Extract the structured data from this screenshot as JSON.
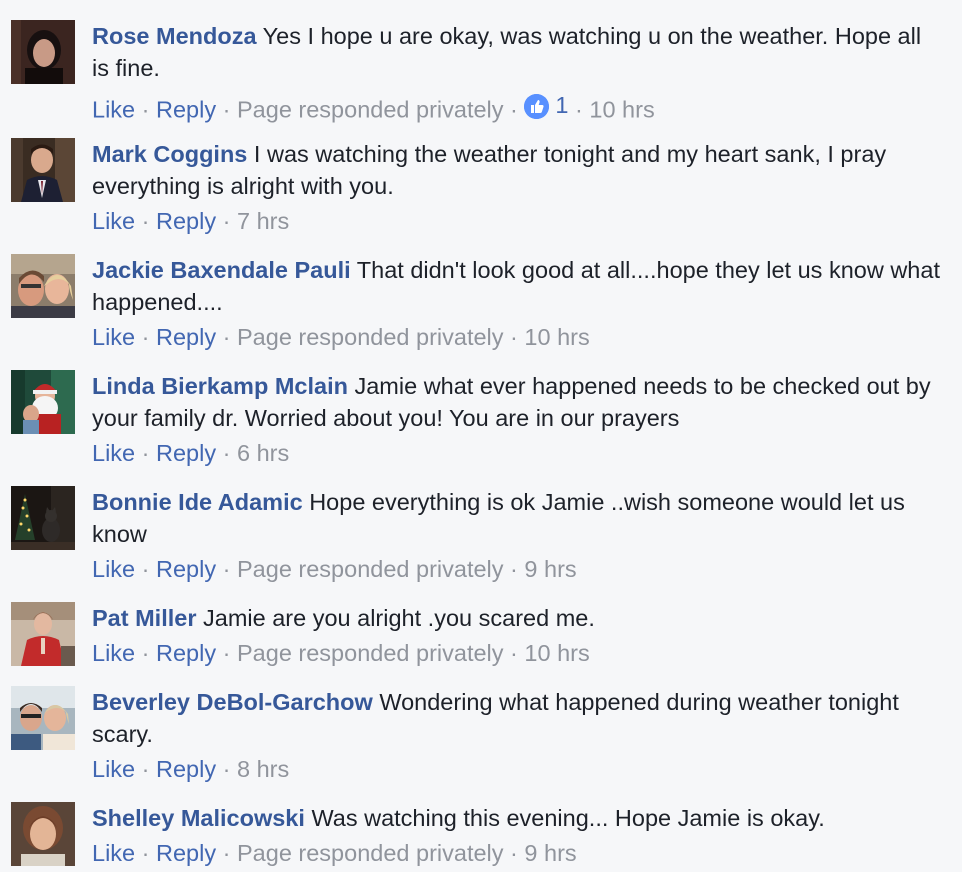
{
  "comments": [
    {
      "author": "Rose Mendoza",
      "text": "Yes I hope u are okay, was watching u on the weather. Hope all is fine.",
      "like_label": "Like",
      "reply_label": "Reply",
      "status": "Page responded privately",
      "like_count": "1",
      "time": "10 hrs",
      "avatar_icon": "avatar-photo-woman-dark-hair"
    },
    {
      "author": "Mark Coggins",
      "text": "I was watching the weather tonight and my heart sank, I pray everything is alright with you.",
      "like_label": "Like",
      "reply_label": "Reply",
      "time": "7 hrs",
      "avatar_icon": "avatar-photo-man-suit"
    },
    {
      "author": "Jackie Baxendale Pauli",
      "text": "That didn't look good at all....hope they let us know what happened....",
      "like_label": "Like",
      "reply_label": "Reply",
      "status": "Page responded privately",
      "time": "10 hrs",
      "avatar_icon": "avatar-photo-couple"
    },
    {
      "author": "Linda Bierkamp Mclain",
      "text": "Jamie what ever happened needs to be checked out by your family dr. Worried about you! You are in our prayers",
      "like_label": "Like",
      "reply_label": "Reply",
      "time": "6 hrs",
      "avatar_icon": "avatar-photo-santa"
    },
    {
      "author": "Bonnie Ide Adamic",
      "text": "Hope everything is ok Jamie ..wish someone would let us know",
      "like_label": "Like",
      "reply_label": "Reply",
      "status": "Page responded privately",
      "time": "9 hrs",
      "avatar_icon": "avatar-photo-cat-christmas-tree"
    },
    {
      "author": "Pat Miller",
      "text": "Jamie are you alright .you scared me.",
      "like_label": "Like",
      "reply_label": "Reply",
      "status": "Page responded privately",
      "time": "10 hrs",
      "avatar_icon": "avatar-photo-woman-red-shirt"
    },
    {
      "author": "Beverley DeBol-Garchow",
      "text": "Wondering what happened during weather tonight scary.",
      "like_label": "Like",
      "reply_label": "Reply",
      "time": "8 hrs",
      "avatar_icon": "avatar-photo-two-women"
    },
    {
      "author": "Shelley Malicowski",
      "text": "Was watching this evening... Hope Jamie is okay.",
      "like_label": "Like",
      "reply_label": "Reply",
      "status": "Page responded privately",
      "time": "9 hrs",
      "avatar_icon": "avatar-photo-older-woman"
    }
  ],
  "colors": {
    "background": "#f6f7f9",
    "author_link": "#365899",
    "action_link": "#4267b2",
    "meta_gray": "#90949c",
    "like_badge": "#5890ff"
  }
}
